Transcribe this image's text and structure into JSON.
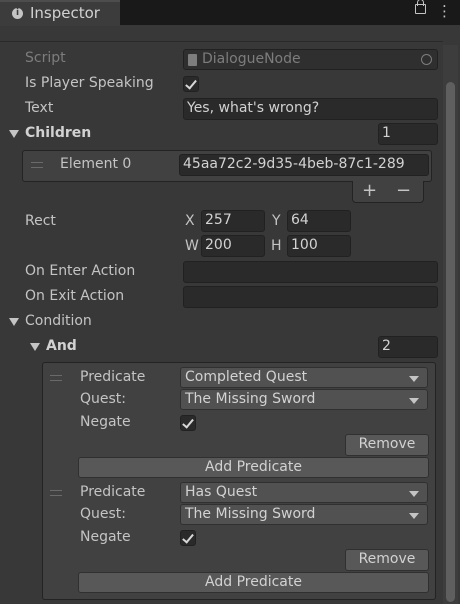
{
  "tab": {
    "title": "Inspector",
    "icon": "info-icon"
  },
  "header_icons": {
    "lock": "lock-icon",
    "menu": "kebab-menu-icon"
  },
  "fields": {
    "script": {
      "label": "Script",
      "value": "DialogueNode"
    },
    "is_player_speaking": {
      "label": "Is Player Speaking",
      "checked": true
    },
    "text": {
      "label": "Text",
      "value": "Yes, what's wrong?"
    },
    "children": {
      "label": "Children",
      "count": "1",
      "element_label": "Element 0",
      "element_value": "45aa72c2-9d35-4beb-87c1-289",
      "add": "+",
      "remove": "−"
    },
    "rect": {
      "label": "Rect",
      "x_label": "X",
      "x": "257",
      "y_label": "Y",
      "y": "64",
      "w_label": "W",
      "w": "200",
      "h_label": "H",
      "h": "100"
    },
    "on_enter": {
      "label": "On Enter Action",
      "value": ""
    },
    "on_exit": {
      "label": "On Exit Action",
      "value": ""
    },
    "condition": {
      "label": "Condition"
    },
    "and": {
      "label": "And",
      "count": "2"
    }
  },
  "predicates": [
    {
      "predicate_label": "Predicate",
      "predicate_value": "Completed Quest",
      "quest_label": "Quest:",
      "quest_value": "The Missing Sword",
      "negate_label": "Negate",
      "negate": true,
      "remove": "Remove",
      "add": "Add Predicate"
    },
    {
      "predicate_label": "Predicate",
      "predicate_value": "Has Quest",
      "quest_label": "Quest:",
      "quest_value": "The Missing Sword",
      "negate_label": "Negate",
      "negate": true,
      "remove": "Remove",
      "add": "Add Predicate"
    }
  ]
}
